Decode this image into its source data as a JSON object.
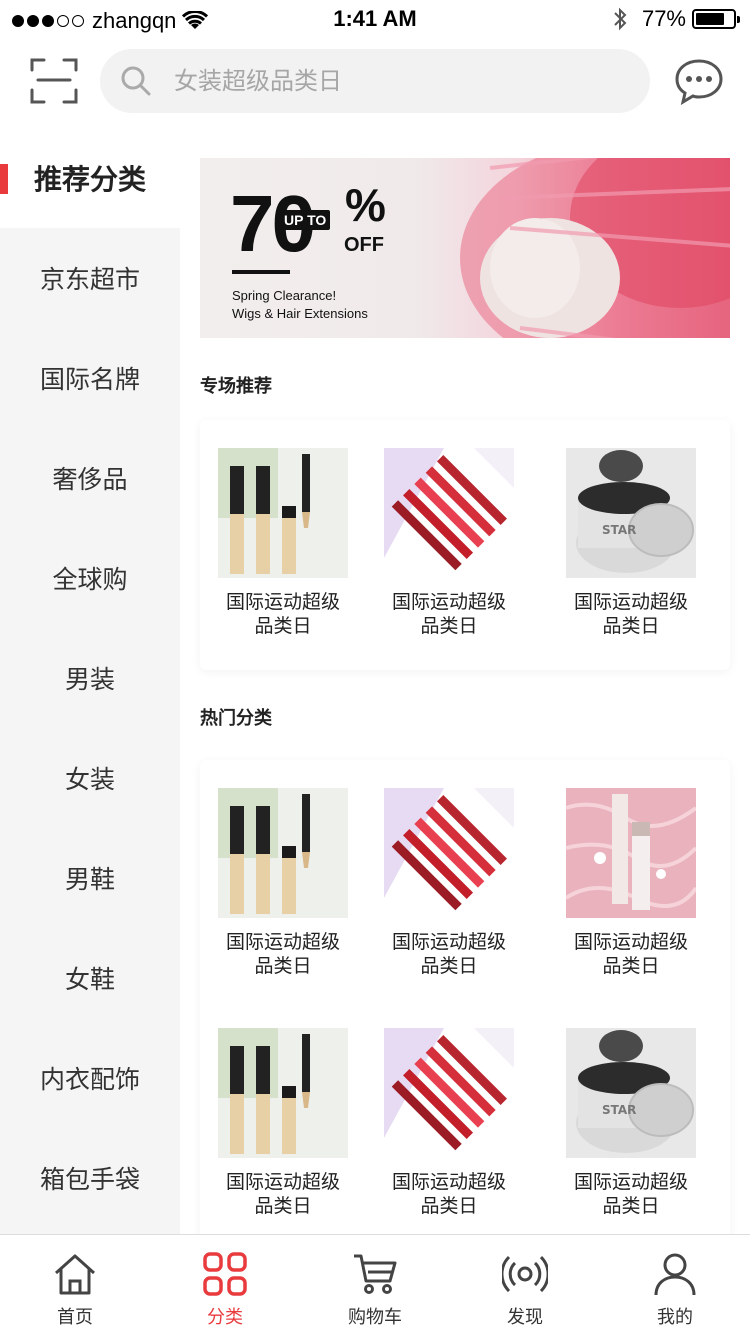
{
  "status_bar": {
    "carrier": "zhangqn",
    "time": "1:41 AM",
    "battery": "77%"
  },
  "header": {
    "search_placeholder": "女装超级品类日"
  },
  "sidebar": {
    "items": [
      {
        "label": "推荐分类",
        "active": true
      },
      {
        "label": "京东超市"
      },
      {
        "label": "国际名牌"
      },
      {
        "label": "奢侈品"
      },
      {
        "label": "全球购"
      },
      {
        "label": "男装"
      },
      {
        "label": "女装"
      },
      {
        "label": "男鞋"
      },
      {
        "label": "女鞋"
      },
      {
        "label": "内衣配饰"
      },
      {
        "label": "箱包手袋"
      }
    ]
  },
  "banner": {
    "big": "70",
    "upto": "UP TO",
    "percent": "%",
    "off": "OFF",
    "line1": "Spring Clearance!",
    "line2": "Wigs & Hair Extensions"
  },
  "sections": {
    "special": {
      "title": "专场推荐",
      "products": [
        {
          "name": "国际运动超级品类日",
          "image": "concealer"
        },
        {
          "name": "国际运动超级品类日",
          "image": "lipgloss"
        },
        {
          "name": "国际运动超级品类日",
          "image": "star-jar"
        }
      ]
    },
    "hot": {
      "title": "热门分类",
      "products": [
        {
          "name": "国际运动超级品类日",
          "image": "concealer"
        },
        {
          "name": "国际运动超级品类日",
          "image": "lipgloss"
        },
        {
          "name": "国际运动超级品类日",
          "image": "pink-tube"
        },
        {
          "name": "国际运动超级品类日",
          "image": "concealer"
        },
        {
          "name": "国际运动超级品类日",
          "image": "lipgloss"
        },
        {
          "name": "国际运动超级品类日",
          "image": "star-jar"
        }
      ]
    }
  },
  "tabbar": {
    "items": [
      {
        "label": "首页",
        "icon": "home-icon"
      },
      {
        "label": "分类",
        "icon": "category-icon",
        "active": true
      },
      {
        "label": "购物车",
        "icon": "cart-icon"
      },
      {
        "label": "发现",
        "icon": "discover-icon"
      },
      {
        "label": "我的",
        "icon": "profile-icon"
      }
    ]
  },
  "colors": {
    "accent": "#e93b3d",
    "sidebar_bg": "#f5f5f5",
    "search_bg": "#f2f2f2"
  }
}
